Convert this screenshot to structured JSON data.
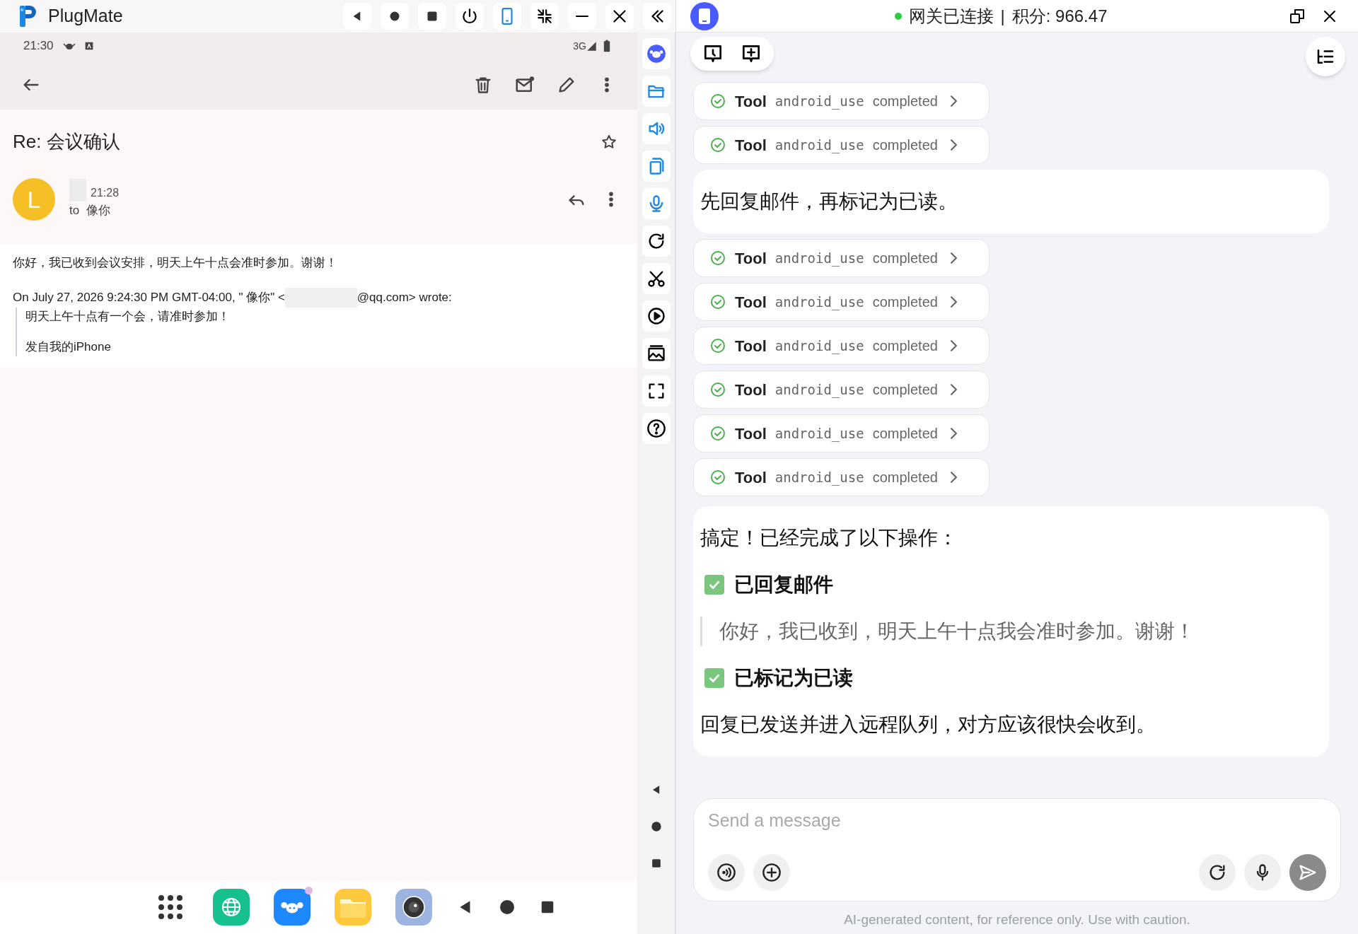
{
  "app": {
    "title": "PlugMate"
  },
  "phone": {
    "status_bar": {
      "time": "21:30",
      "network": "3G"
    },
    "email": {
      "subject": "Re: 会议确认",
      "starred": false,
      "sender_initial": "L",
      "time": "21:28",
      "to_label": "to",
      "recipient": "像你",
      "body": "你好，我已收到会议安排，明天上午十点会准时参加。谢谢！",
      "quote_header_before": "On July 27, 2026 9:24:30 PM GMT-04:00, \" 像你\" <",
      "quote_header_after": "@qq.com> wrote:",
      "quote_lines": [
        "明天上午十点有一个会，请准时参加！",
        "发自我的iPhone"
      ]
    },
    "dock": [
      {
        "kind": "launcher",
        "badge": false
      },
      {
        "kind": "browser",
        "badge": false
      },
      {
        "kind": "robot",
        "badge": true
      },
      {
        "kind": "files",
        "badge": false
      },
      {
        "kind": "camera",
        "badge": false
      }
    ]
  },
  "chat": {
    "header": {
      "connected": true,
      "status": "网关已连接",
      "separator": "|",
      "points": "积分: 966.47"
    },
    "messages": [
      {
        "kind": "tool",
        "label": "Tool",
        "name": "android_use",
        "status": "completed"
      },
      {
        "kind": "tool",
        "label": "Tool",
        "name": "android_use",
        "status": "completed"
      },
      {
        "kind": "user",
        "text": "先回复邮件，再标记为已读。"
      },
      {
        "kind": "tool",
        "label": "Tool",
        "name": "android_use",
        "status": "completed"
      },
      {
        "kind": "tool",
        "label": "Tool",
        "name": "android_use",
        "status": "completed"
      },
      {
        "kind": "tool",
        "label": "Tool",
        "name": "android_use",
        "status": "completed"
      },
      {
        "kind": "tool",
        "label": "Tool",
        "name": "android_use",
        "status": "completed"
      },
      {
        "kind": "tool",
        "label": "Tool",
        "name": "android_use",
        "status": "completed"
      },
      {
        "kind": "tool",
        "label": "Tool",
        "name": "android_use",
        "status": "completed"
      },
      {
        "kind": "assistant",
        "blocks": [
          {
            "kind": "paragraph",
            "text": "搞定！已经完成了以下操作："
          },
          {
            "kind": "check",
            "checked": true,
            "text": "已回复邮件"
          },
          {
            "kind": "quote",
            "text": "你好，我已收到，明天上午十点我会准时参加。谢谢！"
          },
          {
            "kind": "check",
            "checked": true,
            "text": "已标记为已读"
          },
          {
            "kind": "paragraph",
            "text": "回复已发送并进入远程队列，对方应该很快会收到。"
          }
        ]
      }
    ],
    "input": {
      "placeholder": "Send a message"
    },
    "disclaimer": "AI-generated content, for reference only. Use with caution."
  }
}
